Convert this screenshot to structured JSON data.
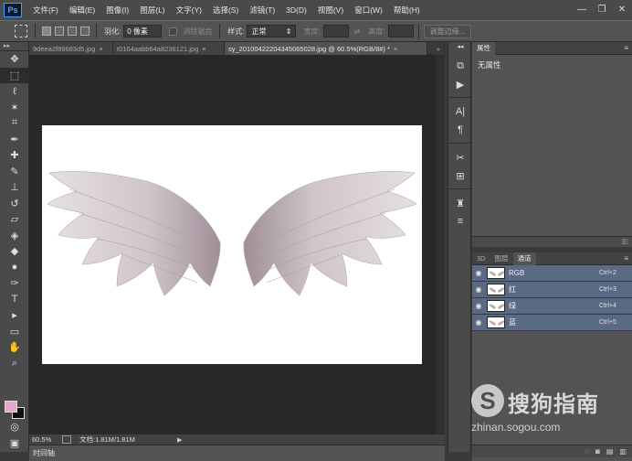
{
  "app": {
    "logo": "Ps"
  },
  "menu": {
    "items": [
      "文件(F)",
      "编辑(E)",
      "图像(I)",
      "图层(L)",
      "文字(Y)",
      "选择(S)",
      "滤镜(T)",
      "3D(D)",
      "视图(V)",
      "窗口(W)",
      "帮助(H)"
    ]
  },
  "window_controls": {
    "minimize": "—",
    "restore": "❐",
    "close": "✕"
  },
  "options_bar": {
    "feather_label": "羽化:",
    "feather_value": "0 像素",
    "antialias_label": "消除锯齿",
    "style_label": "样式:",
    "style_value": "正常",
    "width_label": "宽度:",
    "height_label": "高度:",
    "refine_edge_label": "调整边缘..."
  },
  "doc_tabs": [
    {
      "label": "9deea2f89683d5.jpg",
      "active": false
    },
    {
      "label": "t0164aabb64a8236121.jpg",
      "active": false
    },
    {
      "label": "sy_20100422204345065028.jpg @ 60.5%(RGB/8#) *",
      "active": true
    }
  ],
  "status": {
    "zoom": "60.5%",
    "doc_size": "文档:1.81M/1.81M",
    "timeline_label": "时间轴"
  },
  "properties_panel": {
    "tab_label": "属性",
    "body_text": "无属性"
  },
  "channels_panel": {
    "tabs": [
      {
        "label": "3D",
        "active": false
      },
      {
        "label": "图层",
        "active": false
      },
      {
        "label": "通道",
        "active": true
      }
    ],
    "channels": [
      {
        "name": "RGB",
        "shortcut": "Ctrl+2"
      },
      {
        "name": "红",
        "shortcut": "Ctrl+3"
      },
      {
        "name": "绿",
        "shortcut": "Ctrl+4"
      },
      {
        "name": "蓝",
        "shortcut": "Ctrl+5"
      }
    ]
  },
  "colors": {
    "foreground": "#e6a6d2",
    "background": "#111111",
    "selection_row": "#5a6a82"
  },
  "watermark": {
    "logo_glyph": "S",
    "title": "搜狗指南",
    "url": "zhinan.sogou.com"
  }
}
